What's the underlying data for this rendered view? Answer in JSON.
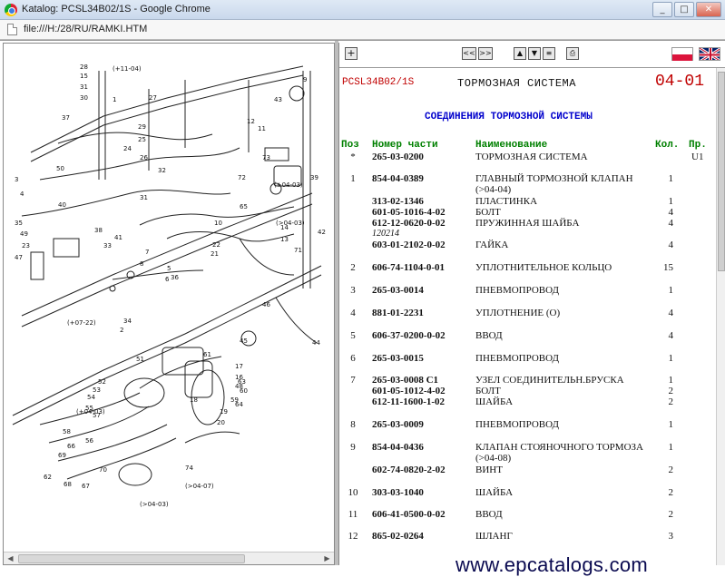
{
  "window": {
    "title": "Katalog: PCSL34B02/1S - Google Chrome",
    "minimize": "_",
    "maximize": "□",
    "close": "✕"
  },
  "address": {
    "url": "file:///H:/28/RU/RAMKI.HTM"
  },
  "toolbar": {
    "expand": "+",
    "prev": "<<",
    "next": ">>",
    "up": "▲",
    "down": "▼",
    "list": "≡",
    "print": "⎙"
  },
  "header": {
    "code": "PCSL34B02/1S",
    "title": "ТОРМОЗНАЯ СИСТЕМА",
    "section": "04-01",
    "subtitle": "СОЕДИНЕНИЯ ТОРМОЗНОЙ СИСТЕМЫ"
  },
  "columns": {
    "pos": "Поз",
    "part": "Номер части",
    "name": "Наименование",
    "qty": "Кол.",
    "pr": "Пр."
  },
  "parts": [
    {
      "pos": "*",
      "part": "265-03-0200",
      "name": "ТОРМОЗНАЯ СИСТЕМА",
      "qty": "",
      "pr": "U1"
    },
    {
      "pos": "1",
      "part": "854-04-0389",
      "name": "ГЛАВНЫЙ ТОРМОЗНОЙ КЛАПАН (>04-04)",
      "qty": "1",
      "pr": ""
    },
    {
      "pos": "",
      "part": "313-02-1346",
      "name": "ПЛАСТИНКА",
      "qty": "1",
      "pr": ""
    },
    {
      "pos": "",
      "part": "601-05-1016-4-02",
      "name": "БОЛТ",
      "qty": "4",
      "pr": ""
    },
    {
      "pos": "",
      "part": "612-12-0620-0-02",
      "name": "ПРУЖИННАЯ ШАЙБА",
      "qty": "4",
      "pr": ""
    },
    {
      "pos": "",
      "part": "120214",
      "name": "",
      "qty": "",
      "pr": ""
    },
    {
      "pos": "",
      "part": "603-01-2102-0-02",
      "name": "ГАЙКА",
      "qty": "4",
      "pr": ""
    },
    {
      "pos": "2",
      "part": "606-74-1104-0-01",
      "name": "УПЛОТНИТЕЛЬНОЕ КОЛЬЦО",
      "qty": "15",
      "pr": ""
    },
    {
      "pos": "3",
      "part": "265-03-0014",
      "name": "ПНЕВМОПРОВОД",
      "qty": "1",
      "pr": ""
    },
    {
      "pos": "4",
      "part": "881-01-2231",
      "name": "УПЛОТНЕНИЕ (О)",
      "qty": "4",
      "pr": ""
    },
    {
      "pos": "5",
      "part": "606-37-0200-0-02",
      "name": "ВВОД",
      "qty": "4",
      "pr": ""
    },
    {
      "pos": "6",
      "part": "265-03-0015",
      "name": "ПНЕВМОПРОВОД",
      "qty": "1",
      "pr": ""
    },
    {
      "pos": "7",
      "part": "265-03-0008 C1",
      "name": "УЗЕЛ СОЕДИНИТЕЛЬН.БРУСКА",
      "qty": "1",
      "pr": ""
    },
    {
      "pos": "",
      "part": "601-05-1012-4-02",
      "name": "БОЛТ",
      "qty": "2",
      "pr": ""
    },
    {
      "pos": "",
      "part": "612-11-1600-1-02",
      "name": "ШАЙБА",
      "qty": "2",
      "pr": ""
    },
    {
      "pos": "8",
      "part": "265-03-0009",
      "name": "ПНЕВМОПРОВОД",
      "qty": "1",
      "pr": ""
    },
    {
      "pos": "9",
      "part": "854-04-0436",
      "name": "КЛАПАН СТОЯНОЧНОГО ТОРМОЗА (>04-08)",
      "qty": "1",
      "pr": ""
    },
    {
      "pos": "",
      "part": "602-74-0820-2-02",
      "name": "ВИНТ",
      "qty": "2",
      "pr": ""
    },
    {
      "pos": "10",
      "part": "303-03-1040",
      "name": "ШАЙБА",
      "qty": "2",
      "pr": ""
    },
    {
      "pos": "11",
      "part": "606-41-0500-0-02",
      "name": "ВВОД",
      "qty": "2",
      "pr": ""
    },
    {
      "pos": "12",
      "part": "865-02-0264",
      "name": "ШЛАНГ",
      "qty": "3",
      "pr": ""
    }
  ],
  "diagram_labels": [
    "28",
    "15",
    "31",
    "30",
    "1",
    "27",
    "9",
    "12",
    "11",
    "37",
    "29",
    "25",
    "24",
    "50",
    "26",
    "3",
    "4",
    "32",
    "40",
    "31",
    "35",
    "23",
    "47",
    "38",
    "33",
    "41",
    "49",
    "43",
    "42",
    "22",
    "21",
    "65",
    "10",
    "44",
    "46",
    "48",
    "34",
    "2",
    "36",
    "39",
    "56",
    "61",
    "51",
    "53",
    "14",
    "13",
    "6",
    "5",
    "7",
    "8",
    "16",
    "17",
    "18",
    "19",
    "20",
    "45",
    "52",
    "54",
    "55",
    "57",
    "58",
    "59",
    "60",
    "62",
    "63",
    "64",
    "66",
    "67",
    "68",
    "69",
    "70",
    "71",
    "72",
    "73",
    "74"
  ],
  "diagram_refs": [
    "(+11-04)",
    "(+04-03)",
    "(+07-22)",
    "(+04-03)",
    "(>04-07)",
    "(>04-03)",
    "(>04-03)"
  ],
  "watermark": "www.epcatalogs.com"
}
